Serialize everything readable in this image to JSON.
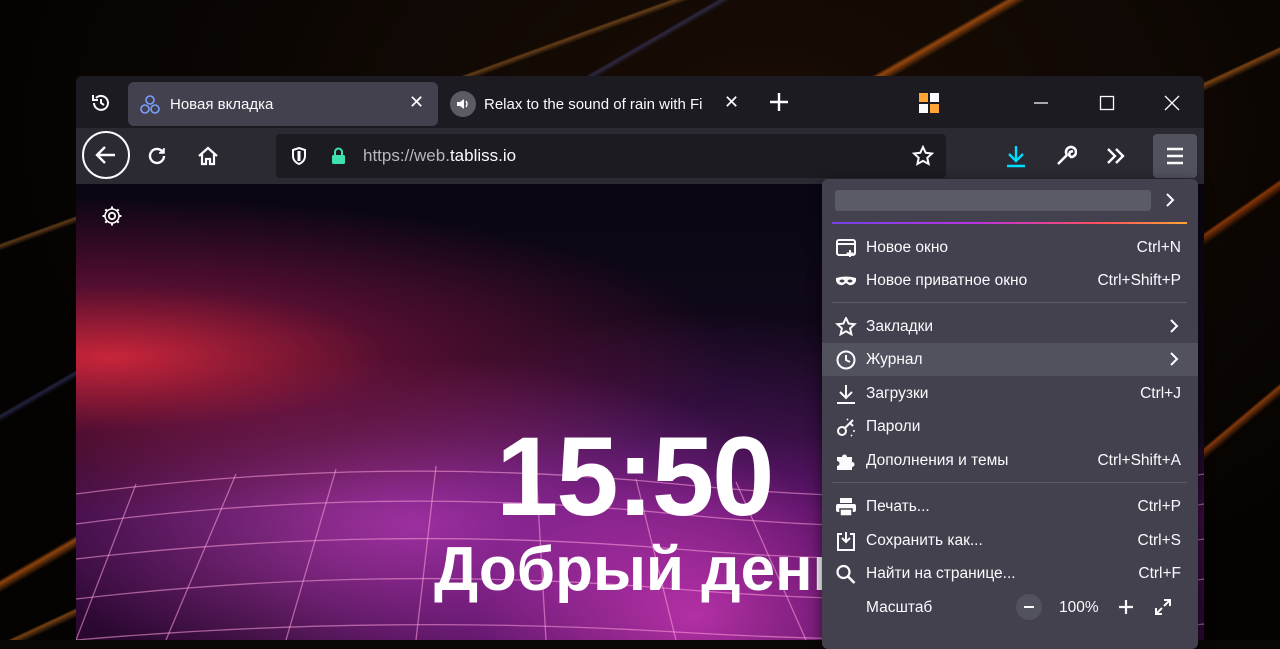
{
  "tabs": [
    {
      "title": "Новая вкладка",
      "active": true
    },
    {
      "title": "Relax to the sound of rain with Fi",
      "active": false
    }
  ],
  "navbar": {
    "url_prefix": "https://web.",
    "url_domain": "tabliss.io"
  },
  "page": {
    "clock": "15:50",
    "greeting": "Добрый день"
  },
  "menu": {
    "items": [
      {
        "label": "Новое окно",
        "shortcut": "Ctrl+N",
        "icon": "new-window-icon"
      },
      {
        "label": "Новое приватное окно",
        "shortcut": "Ctrl+Shift+P",
        "icon": "private-mask-icon"
      },
      {
        "label": "Закладки",
        "icon": "star-icon"
      },
      {
        "label": "Журнал",
        "icon": "clock-icon"
      },
      {
        "label": "Загрузки",
        "shortcut": "Ctrl+J",
        "icon": "download-icon"
      },
      {
        "label": "Пароли",
        "icon": "key-icon"
      },
      {
        "label": "Дополнения и темы",
        "shortcut": "Ctrl+Shift+A",
        "icon": "puzzle-icon"
      },
      {
        "label": "Печать...",
        "shortcut": "Ctrl+P",
        "icon": "printer-icon"
      },
      {
        "label": "Сохранить как...",
        "shortcut": "Ctrl+S",
        "icon": "save-icon"
      },
      {
        "label": "Найти на странице...",
        "shortcut": "Ctrl+F",
        "icon": "search-icon"
      }
    ],
    "zoom": {
      "label": "Масштаб",
      "value": "100%"
    }
  },
  "colors": {
    "accent_download": "#00ddff",
    "lock_green": "#3fe1b0",
    "menu_bg": "#42414d",
    "highlight": "#52525e"
  }
}
